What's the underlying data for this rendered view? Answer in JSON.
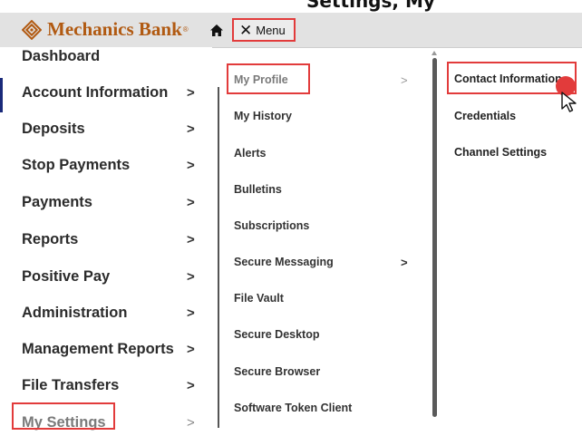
{
  "caption_fragment": "Settings, My",
  "header": {
    "logo_text": "Mechanics Bank",
    "logo_reg": "®",
    "menu_label": "Menu",
    "menu_close_glyph": "✕"
  },
  "left_nav": {
    "items": [
      {
        "label": "Dashboard",
        "chevron": ""
      },
      {
        "label": "Account Information",
        "chevron": ">"
      },
      {
        "label": "Deposits",
        "chevron": ">"
      },
      {
        "label": "Stop Payments",
        "chevron": ">"
      },
      {
        "label": "Payments",
        "chevron": ">"
      },
      {
        "label": "Reports",
        "chevron": ">"
      },
      {
        "label": "Positive Pay",
        "chevron": ">"
      },
      {
        "label": "Administration",
        "chevron": ">"
      },
      {
        "label": "Management Reports",
        "chevron": ">"
      },
      {
        "label": "File Transfers",
        "chevron": ">"
      },
      {
        "label": "My Settings",
        "chevron": ">"
      }
    ]
  },
  "middle_menu": {
    "items": [
      {
        "label": "My Profile",
        "chevron": ">"
      },
      {
        "label": "My History",
        "chevron": ""
      },
      {
        "label": "Alerts",
        "chevron": ""
      },
      {
        "label": "Bulletins",
        "chevron": ""
      },
      {
        "label": "Subscriptions",
        "chevron": ""
      },
      {
        "label": "Secure Messaging",
        "chevron": ">"
      },
      {
        "label": "File Vault",
        "chevron": ""
      },
      {
        "label": "Secure Desktop",
        "chevron": ""
      },
      {
        "label": "Secure Browser",
        "chevron": ""
      },
      {
        "label": "Software Token Client",
        "chevron": ""
      }
    ]
  },
  "right_menu": {
    "items": [
      {
        "label": "Contact Information"
      },
      {
        "label": "Credentials"
      },
      {
        "label": "Channel Settings"
      }
    ]
  },
  "colors": {
    "brand": "#b15a12",
    "highlight_border": "#e23b3b",
    "header_bg": "#e2e2e2",
    "active_text": "#7a7a7a"
  },
  "icons": [
    "brand-logo-icon",
    "home-icon",
    "close-icon",
    "chevron-right-icon",
    "mouse-pointer-icon"
  ]
}
